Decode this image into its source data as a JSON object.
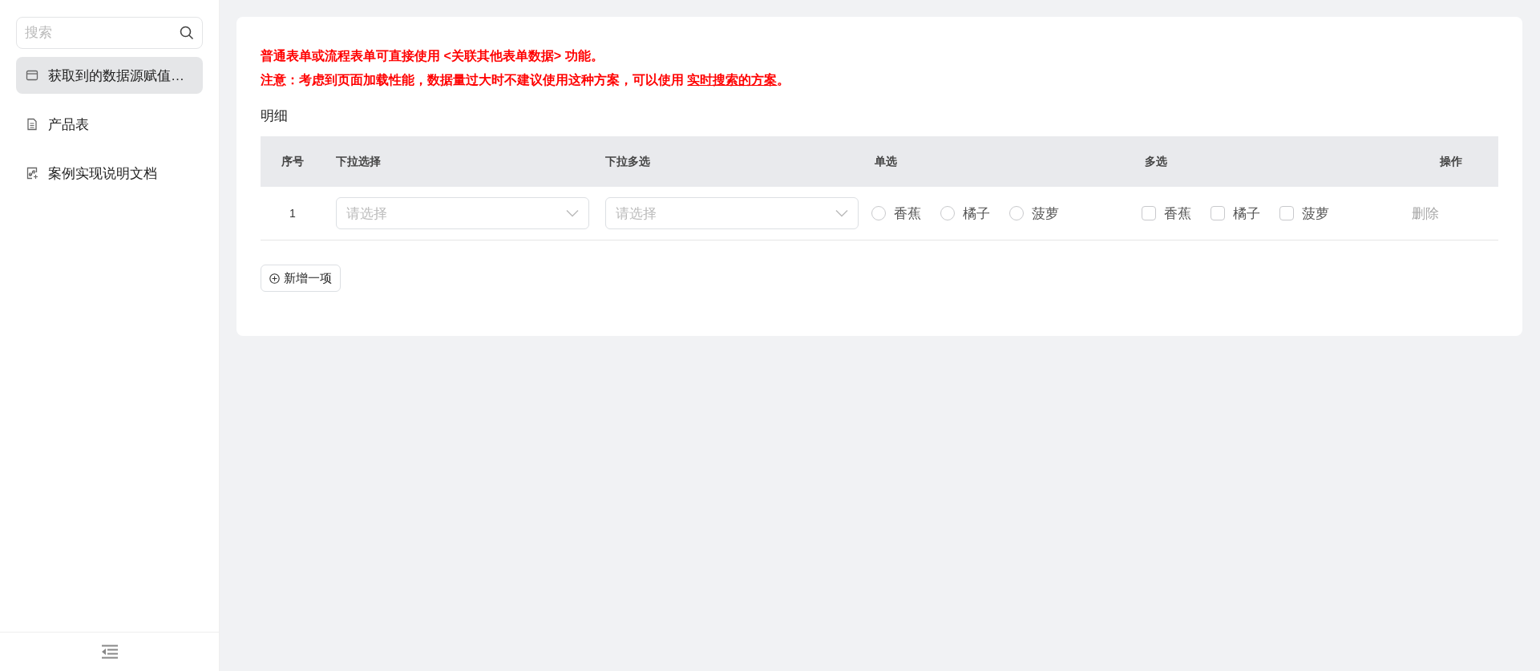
{
  "sidebar": {
    "search": {
      "placeholder": "搜索"
    },
    "items": [
      {
        "label": "获取到的数据源赋值…",
        "kind": "window",
        "selected": true
      },
      {
        "label": "产品表",
        "kind": "document",
        "selected": false
      },
      {
        "label": "案例实现说明文档",
        "kind": "link-doc",
        "selected": false
      }
    ]
  },
  "notice": {
    "line_1": "普通表单或流程表单可直接使用 <关联其他表单数据> 功能。",
    "line_2": {
      "text": "注意：考虑到页面加载性能，数据量过大时不建议使用这种方案，可以使用 ",
      "link": "实时搜索的方案",
      "text_after": "。"
    }
  },
  "section_title": "明细",
  "table": {
    "columns": [
      "序号",
      "下拉选择",
      "下拉多选",
      "单选",
      "多选",
      "操作"
    ],
    "rows": [
      {
        "index": "1",
        "select": {
          "placeholder": "请选择"
        },
        "multi_select": {
          "placeholder": "请选择"
        },
        "radio": [
          {
            "label": "香蕉",
            "selected": false
          },
          {
            "label": "橘子",
            "selected": false
          },
          {
            "label": "菠萝",
            "selected": false
          }
        ],
        "checkboxes": [
          {
            "label": "香蕉",
            "checked": false
          },
          {
            "label": "橘子",
            "checked": false
          },
          {
            "label": "菠萝",
            "checked": false
          }
        ],
        "action": "删除"
      }
    ]
  },
  "add_button": "新增一项"
}
